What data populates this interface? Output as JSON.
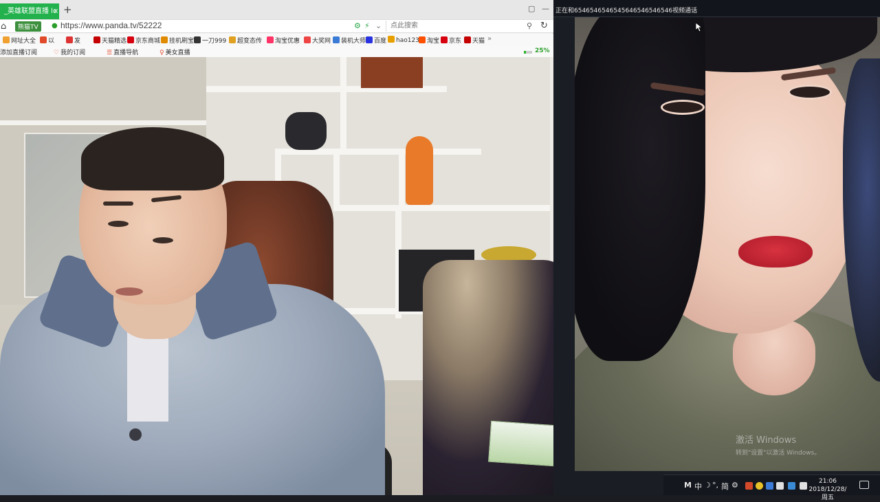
{
  "browser": {
    "tab": {
      "title": "_英雄联盟直播 lc",
      "close": "×"
    },
    "new_tab": "+",
    "window_controls": [
      "▢",
      "—"
    ],
    "address": {
      "site_badge": "熊猫TV",
      "url": "https://www.panda.tv/52222",
      "search_placeholder": "点此搜索"
    },
    "bookmarks": [
      {
        "label": "网址大全",
        "color": "#f0a030"
      },
      {
        "label": "以",
        "color": "#e04a2a"
      },
      {
        "label": "发",
        "color": "#d33"
      },
      {
        "label": "天猫精选",
        "color": "#c40000"
      },
      {
        "label": "京东商城",
        "color": "#d7000f"
      },
      {
        "label": "挂机刷宝",
        "color": "#e08a00"
      },
      {
        "label": "一刀999",
        "color": "#333"
      },
      {
        "label": "超变态传",
        "color": "#e0a020"
      },
      {
        "label": "淘宝优惠",
        "color": "#f36"
      },
      {
        "label": "大奖网",
        "color": "#e44"
      },
      {
        "label": "装机大师",
        "color": "#3a7bd5"
      },
      {
        "label": "百度",
        "color": "#2932e1"
      },
      {
        "label": "hao123",
        "color": "#e8a000"
      },
      {
        "label": "淘宝",
        "color": "#ff5000"
      },
      {
        "label": "京东",
        "color": "#d7000f"
      },
      {
        "label": "天猫",
        "color": "#c40000"
      }
    ],
    "bookmarks_more": "»",
    "panda_nav": [
      {
        "label": "添加直播订阅",
        "icon": ""
      },
      {
        "label": "我的订阅",
        "icon": "♡"
      },
      {
        "label": "直播导航",
        "icon": "☰"
      },
      {
        "label": "美女直播",
        "icon": "♀"
      }
    ],
    "progress": {
      "percent": 25,
      "label": "25%"
    }
  },
  "call_window": {
    "title": "正在和6546546546545646546546546视频通话",
    "watermark_title": "激活 Windows",
    "watermark_sub": "转到\"设置\"以激活 Windows。"
  },
  "taskbar": {
    "tray_text": [
      "M",
      "中",
      "☽",
      "°,",
      "简",
      "⚙"
    ],
    "tray_icons": [
      {
        "name": "tray-app1",
        "color": "#d24a2a"
      },
      {
        "name": "tray-app2",
        "color": "#e8c12a"
      },
      {
        "name": "tray-app3",
        "color": "#3c7bd6"
      },
      {
        "name": "tray-app4",
        "color": "#e0e0e0"
      },
      {
        "name": "tray-app5",
        "color": "#3a8ad6"
      },
      {
        "name": "tray-app6",
        "color": "#e0e0e0"
      },
      {
        "name": "tray-app7",
        "color": "#e0e0e0"
      }
    ],
    "time": "21:06",
    "date": "2018/12/28/周五"
  }
}
